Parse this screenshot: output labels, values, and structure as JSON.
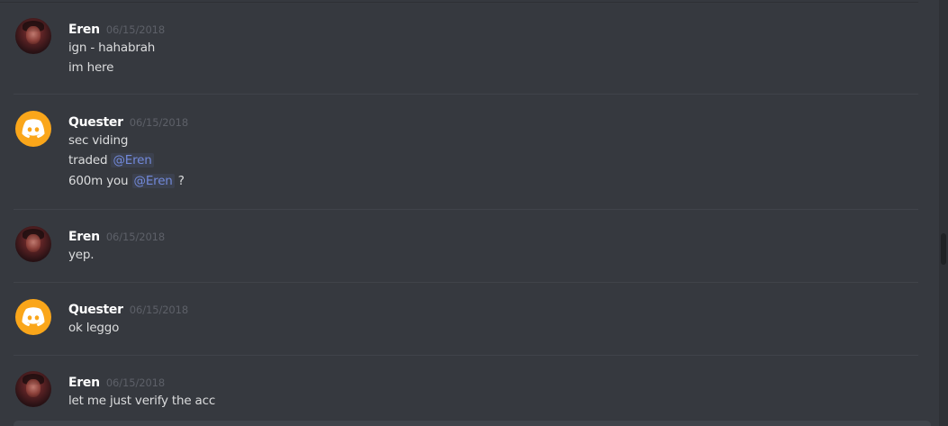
{
  "messages": [
    {
      "author": "Eren",
      "timestamp": "06/15/2018",
      "avatar": "eren-avatar",
      "lines": [
        {
          "text": "ign - hahabrah"
        },
        {
          "text": "im here"
        }
      ]
    },
    {
      "author": "Quester",
      "timestamp": "06/15/2018",
      "avatar": "discord-logo-icon",
      "lines": [
        {
          "text": "sec viding"
        },
        {
          "prefix": "traded ",
          "mention": "@Eren",
          "suffix": ""
        },
        {
          "prefix": "600m you ",
          "mention": "@Eren",
          "suffix": " ?"
        }
      ]
    },
    {
      "author": "Eren",
      "timestamp": "06/15/2018",
      "avatar": "eren-avatar",
      "lines": [
        {
          "text": "yep."
        }
      ]
    },
    {
      "author": "Quester",
      "timestamp": "06/15/2018",
      "avatar": "discord-logo-icon",
      "lines": [
        {
          "text": "ok leggo"
        }
      ]
    },
    {
      "author": "Eren",
      "timestamp": "06/15/2018",
      "avatar": "eren-avatar",
      "lines": [
        {
          "text": "let me just verify the acc"
        }
      ]
    }
  ],
  "colors": {
    "background": "#36393f",
    "username": "#ffffff",
    "timestamp": "#5d6068",
    "message_text": "#dcddde",
    "mention": "#7289da",
    "quester_avatar": "#faa61a"
  }
}
